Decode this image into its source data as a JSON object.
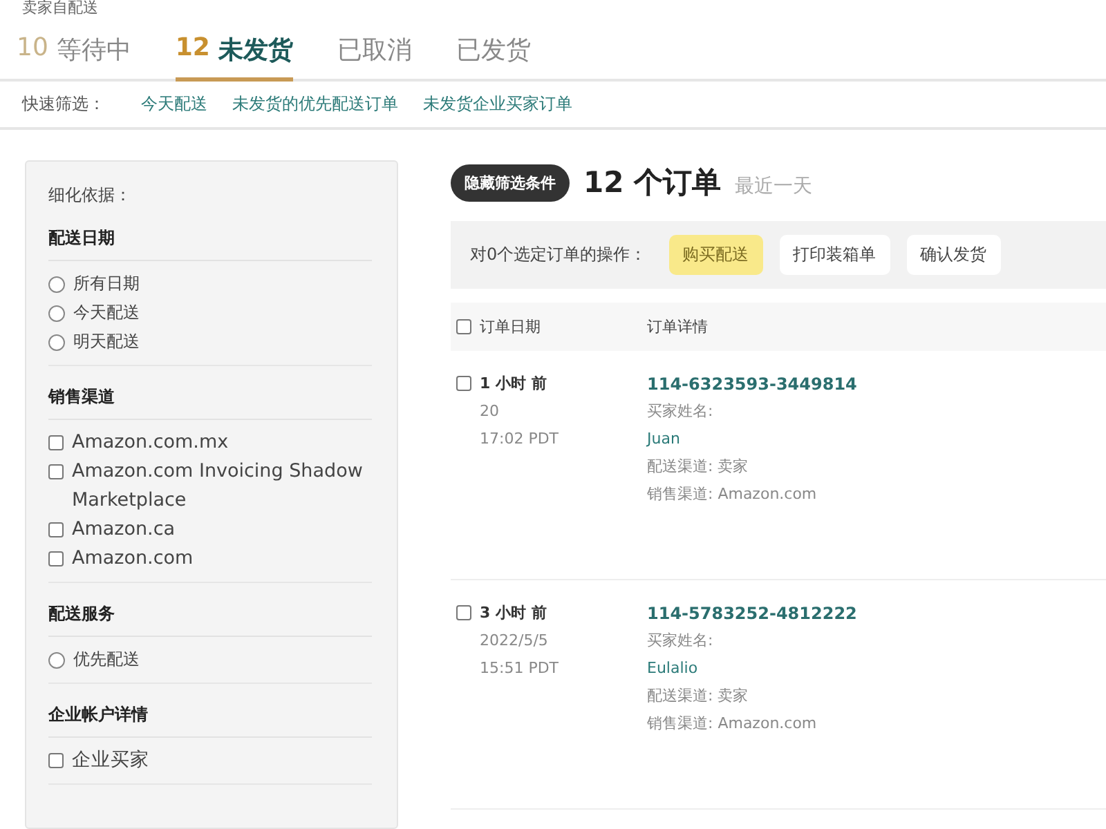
{
  "header": {
    "title": "卖家自配送"
  },
  "tabs": [
    {
      "count": "10",
      "label": "等待中",
      "selected": false
    },
    {
      "count": "12",
      "label": "未发货",
      "selected": true
    },
    {
      "label": "已取消",
      "selected": false
    },
    {
      "label": "已发货",
      "selected": false
    }
  ],
  "quick_filters": {
    "label": "快速筛选：",
    "links": [
      "今天配送",
      "未发货的优先配送订单",
      "未发货企业买家订单"
    ]
  },
  "sidebar": {
    "title": "细化依据：",
    "sections": [
      {
        "heading": "配送日期",
        "options": [
          {
            "kind": "radio",
            "label": "所有日期",
            "checked": false
          },
          {
            "kind": "radio",
            "label": "今天配送",
            "checked": false
          },
          {
            "kind": "radio",
            "label": "明天配送",
            "checked": false
          }
        ]
      },
      {
        "heading": "销售渠道",
        "options": [
          {
            "kind": "checkbox",
            "label": "Amazon.com.mx",
            "checked": false
          },
          {
            "kind": "checkbox",
            "label": "Amazon.com Invoicing Shadow Marketplace",
            "checked": false
          },
          {
            "kind": "checkbox",
            "label": "Amazon.ca",
            "checked": false
          },
          {
            "kind": "checkbox",
            "label": "Amazon.com",
            "checked": false
          }
        ]
      },
      {
        "heading": "配送服务",
        "options": [
          {
            "kind": "radio",
            "label": "优先配送",
            "checked": false
          }
        ]
      },
      {
        "heading": "企业帐户详情",
        "options": [
          {
            "kind": "checkbox",
            "label": "企业买家",
            "checked": false
          }
        ]
      }
    ]
  },
  "orders": {
    "hide_filters_button": "隐藏筛选条件",
    "count": "12 个订单",
    "period": "最近一天",
    "actions": {
      "label": "对0个选定订单的操作：",
      "buttons": [
        {
          "label": "购买配送",
          "primary": true
        },
        {
          "label": "打印装箱单",
          "primary": false
        },
        {
          "label": "确认发货",
          "primary": false
        }
      ]
    },
    "select_all_checked": false,
    "columns": [
      "订单日期",
      "订单详情"
    ],
    "rows": [
      {
        "checked": false,
        "age": "1 小时 前",
        "date": "20",
        "time": "17:02 PDT",
        "order_id": "114-6323593-3449814",
        "buyer_label": "买家姓名:",
        "buyer": "Juan",
        "fulfillment": "配送渠道: 卖家",
        "channel": "销售渠道: Amazon.com"
      },
      {
        "checked": false,
        "age": "3 小时 前",
        "date": "2022/5/5",
        "time": "15:51 PDT",
        "order_id": "114-5783252-4812222",
        "buyer_label": "买家姓名:",
        "buyer": "Eulalio",
        "fulfillment": "配送渠道: 卖家",
        "channel": "销售渠道: Amazon.com"
      }
    ]
  }
}
